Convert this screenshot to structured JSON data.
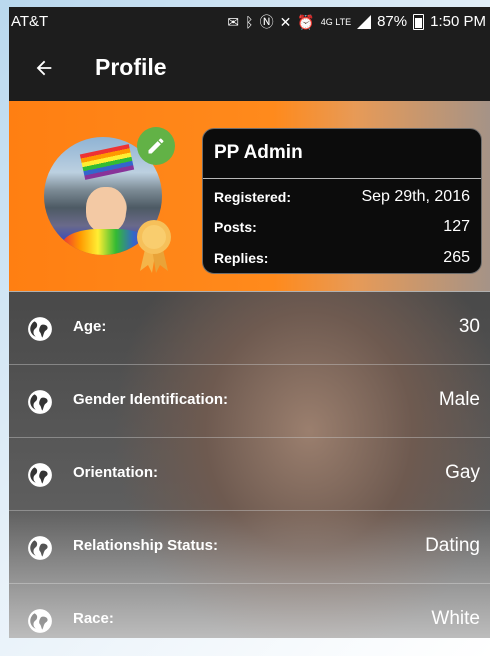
{
  "status_bar": {
    "carrier": "AT&T",
    "battery": "87%",
    "time": "1:50 PM",
    "network": "4G LTE",
    "icons": [
      "message-icon",
      "bluetooth-icon",
      "nfc-icon",
      "mute-icon",
      "alarm-icon",
      "lte-icon",
      "signal-icon",
      "battery-icon"
    ]
  },
  "app_bar": {
    "title": "Profile",
    "back_icon": "arrow-left-icon"
  },
  "profile": {
    "name": "PP Admin",
    "edit_icon": "pencil-icon",
    "badge_icon": "award-ribbon-icon",
    "stats": [
      {
        "label": "Registered:",
        "value": "Sep 29th, 2016"
      },
      {
        "label": "Posts:",
        "value": "127"
      },
      {
        "label": "Replies:",
        "value": "265"
      }
    ]
  },
  "details": [
    {
      "label": "Age:",
      "value": "30",
      "icon": "globe-icon"
    },
    {
      "label": "Gender Identification:",
      "value": "Male",
      "icon": "globe-icon"
    },
    {
      "label": "Orientation:",
      "value": "Gay",
      "icon": "globe-icon"
    },
    {
      "label": "Relationship Status:",
      "value": "Dating",
      "icon": "globe-icon"
    },
    {
      "label": "Race:",
      "value": "White",
      "icon": "globe-icon"
    }
  ],
  "colors": {
    "header_orange": "#ff7f12",
    "edit_green": "#62b246",
    "award_gold": "#f4b54a",
    "bar_dark": "#1d1d1d"
  }
}
